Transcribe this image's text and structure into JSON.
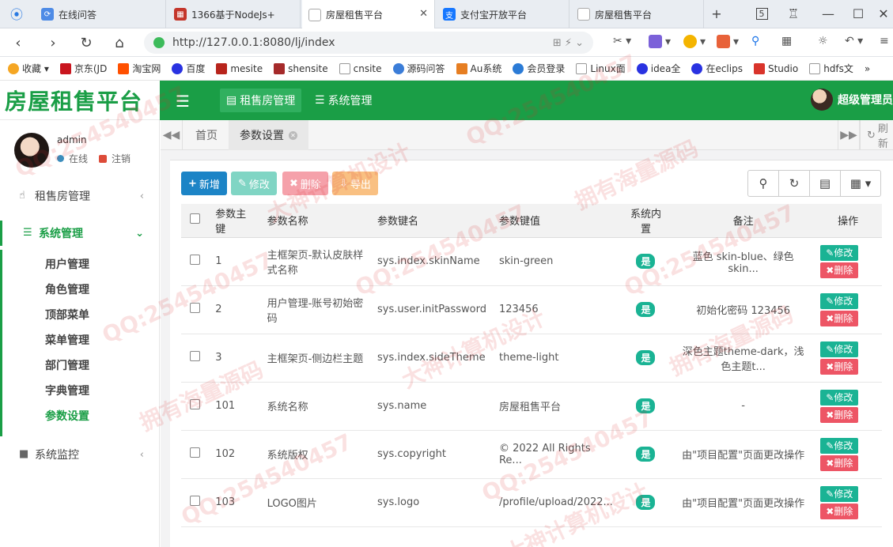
{
  "browser": {
    "tabs": [
      {
        "label": "在线问答"
      },
      {
        "label": "1366基于NodeJs+"
      },
      {
        "label": "房屋租售平台"
      },
      {
        "label": "支付宝开放平台"
      },
      {
        "label": "房屋租售平台"
      }
    ],
    "new_tab": "+",
    "tab_count": "5",
    "url": "http://127.0.0.1:8080/lj/index",
    "bookmarks": [
      "收藏",
      "京东(JD",
      "淘宝网",
      "百度",
      "mesite",
      "shensite",
      "cnsite",
      "源码问答",
      "Au系统",
      "会员登录",
      "Linux面",
      "idea全",
      "在eclips",
      "Studio",
      "hdfs文"
    ],
    "more": "»"
  },
  "app": {
    "brand": "房屋租售平台",
    "top_menu": [
      "租售房管理",
      "系统管理"
    ],
    "user_name": "超级管理员",
    "accent": "#1a9e46"
  },
  "sidebar": {
    "user": "admin",
    "status": "在线",
    "logout": "注销",
    "groups": [
      {
        "label": "租售房管理"
      },
      {
        "label": "系统管理"
      },
      {
        "label": "系统监控"
      }
    ],
    "sub_items": [
      "用户管理",
      "角色管理",
      "顶部菜单",
      "菜单管理",
      "部门管理",
      "字典管理",
      "参数设置"
    ]
  },
  "content_tabs": {
    "home": "首页",
    "active": "参数设置",
    "refresh": "刷新"
  },
  "toolbar": {
    "add": "新增",
    "edit": "修改",
    "delete": "删除",
    "export": "导出"
  },
  "table": {
    "headers": [
      "参数主键",
      "参数名称",
      "参数键名",
      "参数键值",
      "系统内置",
      "备注",
      "操作"
    ],
    "rows": [
      {
        "id": "1",
        "name": "主框架页-默认皮肤样式名称",
        "key": "sys.index.skinName",
        "value": "skin-green",
        "builtin": "是",
        "remark": "蓝色 skin-blue、绿色 skin..."
      },
      {
        "id": "2",
        "name": "用户管理-账号初始密码",
        "key": "sys.user.initPassword",
        "value": "123456",
        "builtin": "是",
        "remark": "初始化密码 123456"
      },
      {
        "id": "3",
        "name": "主框架页-侧边栏主题",
        "key": "sys.index.sideTheme",
        "value": "theme-light",
        "builtin": "是",
        "remark": "深色主题theme-dark，浅色主题t..."
      },
      {
        "id": "101",
        "name": "系统名称",
        "key": "sys.name",
        "value": "房屋租售平台",
        "builtin": "是",
        "remark": "-"
      },
      {
        "id": "102",
        "name": "系统版权",
        "key": "sys.copyright",
        "value": "© 2022 All Rights Re...",
        "builtin": "是",
        "remark": "由\"项目配置\"页面更改操作"
      },
      {
        "id": "103",
        "name": "LOGO图片",
        "key": "sys.logo",
        "value": "/profile/upload/2022...",
        "builtin": "是",
        "remark": "由\"项目配置\"页面更改操作"
      }
    ],
    "op_edit": "修改",
    "op_delete": "删除"
  },
  "watermarks": [
    "QQ:254540457",
    "拥有海量源码",
    "大神计算机设计"
  ]
}
